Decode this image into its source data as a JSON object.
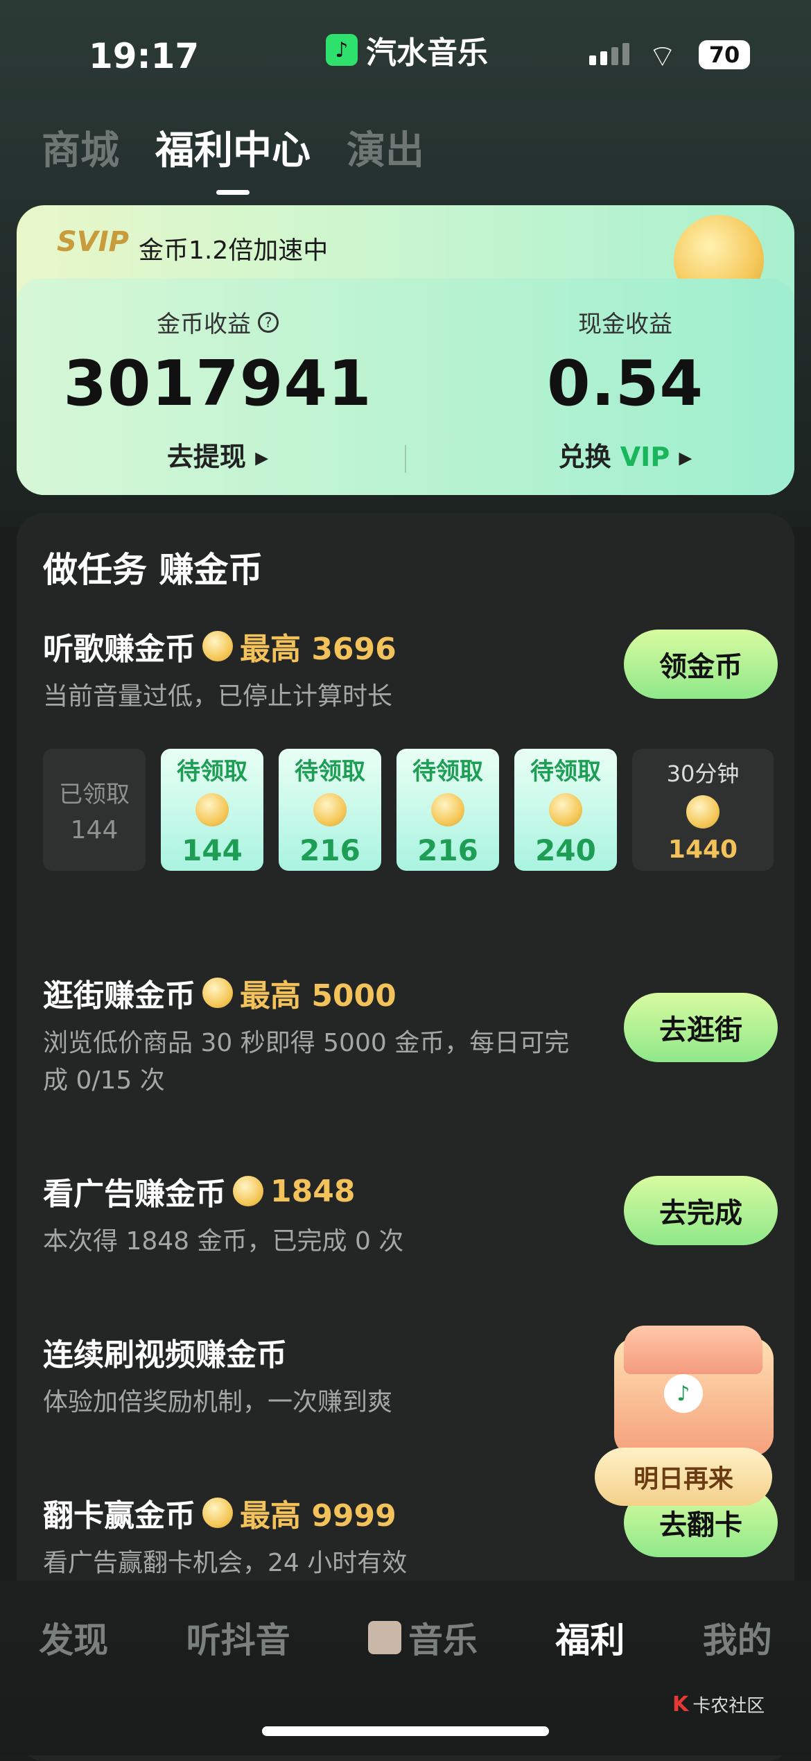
{
  "status": {
    "time": "19:17",
    "app_name": "汽水音乐",
    "battery": "70"
  },
  "tabs": [
    "商城",
    "福利中心",
    "演出"
  ],
  "earnings": {
    "svip_badge": "SVIP",
    "svip_text": "金币1.2倍加速中",
    "coin_label": "金币收益",
    "coin_value": "3017941",
    "withdraw_label": "去提现",
    "cash_label": "现金收益",
    "cash_value": "0.54",
    "redeem_label": "兑换",
    "redeem_vip": "VIP"
  },
  "tasks": {
    "title": "做任务 赚金币",
    "items": [
      {
        "name": "听歌赚金币",
        "reward": "最高 3696",
        "desc": "当前音量过低，已停止计算时长",
        "button": "领金币"
      },
      {
        "name": "逛街赚金币",
        "reward": "最高 5000",
        "desc": "浏览低价商品 30 秒即得 5000 金币，每日可完成 0/15 次",
        "button": "去逛街"
      },
      {
        "name": "看广告赚金币",
        "reward": "1848",
        "desc": "本次得 1848 金币，已完成 0 次",
        "button": "去完成"
      },
      {
        "name": "连续刷视频赚金币",
        "desc": "体验加倍奖励机制，一次赚到爽"
      },
      {
        "name": "翻卡赢金币",
        "reward": "最高 9999",
        "desc": "看广告赢翻卡机会，24 小时有效",
        "button": "去翻卡"
      }
    ],
    "chest_label": "明日再来"
  },
  "slots": [
    {
      "status": "已领取",
      "value": "144"
    },
    {
      "status": "待领取",
      "value": "144"
    },
    {
      "status": "待领取",
      "value": "216"
    },
    {
      "status": "待领取",
      "value": "216"
    },
    {
      "status": "待领取",
      "value": "240"
    },
    {
      "status": "30分钟",
      "value": "1440"
    }
  ],
  "nav": [
    "发现",
    "听抖音",
    "音乐",
    "福利",
    "我的"
  ],
  "watermark": "卡农社区"
}
